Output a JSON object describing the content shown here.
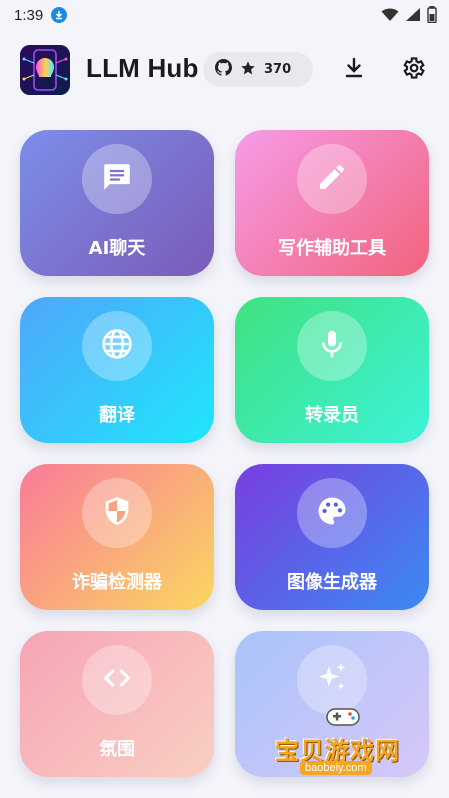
{
  "status_bar": {
    "time": "1:39"
  },
  "header": {
    "title": "LLM Hub",
    "stars": "370"
  },
  "cards": [
    {
      "label": "AI聊天",
      "icon": "chat-icon"
    },
    {
      "label": "写作辅助工具",
      "icon": "pencil-icon"
    },
    {
      "label": "翻译",
      "icon": "globe-icon"
    },
    {
      "label": "转录员",
      "icon": "microphone-icon"
    },
    {
      "label": "诈骗检测器",
      "icon": "shield-icon"
    },
    {
      "label": "图像生成器",
      "icon": "palette-icon"
    },
    {
      "label": "氛围",
      "icon": "code-icon"
    },
    {
      "label": "",
      "icon": "sparkles-icon"
    }
  ],
  "watermark": {
    "text": "宝贝游戏网",
    "url": "baobeiy.com"
  }
}
